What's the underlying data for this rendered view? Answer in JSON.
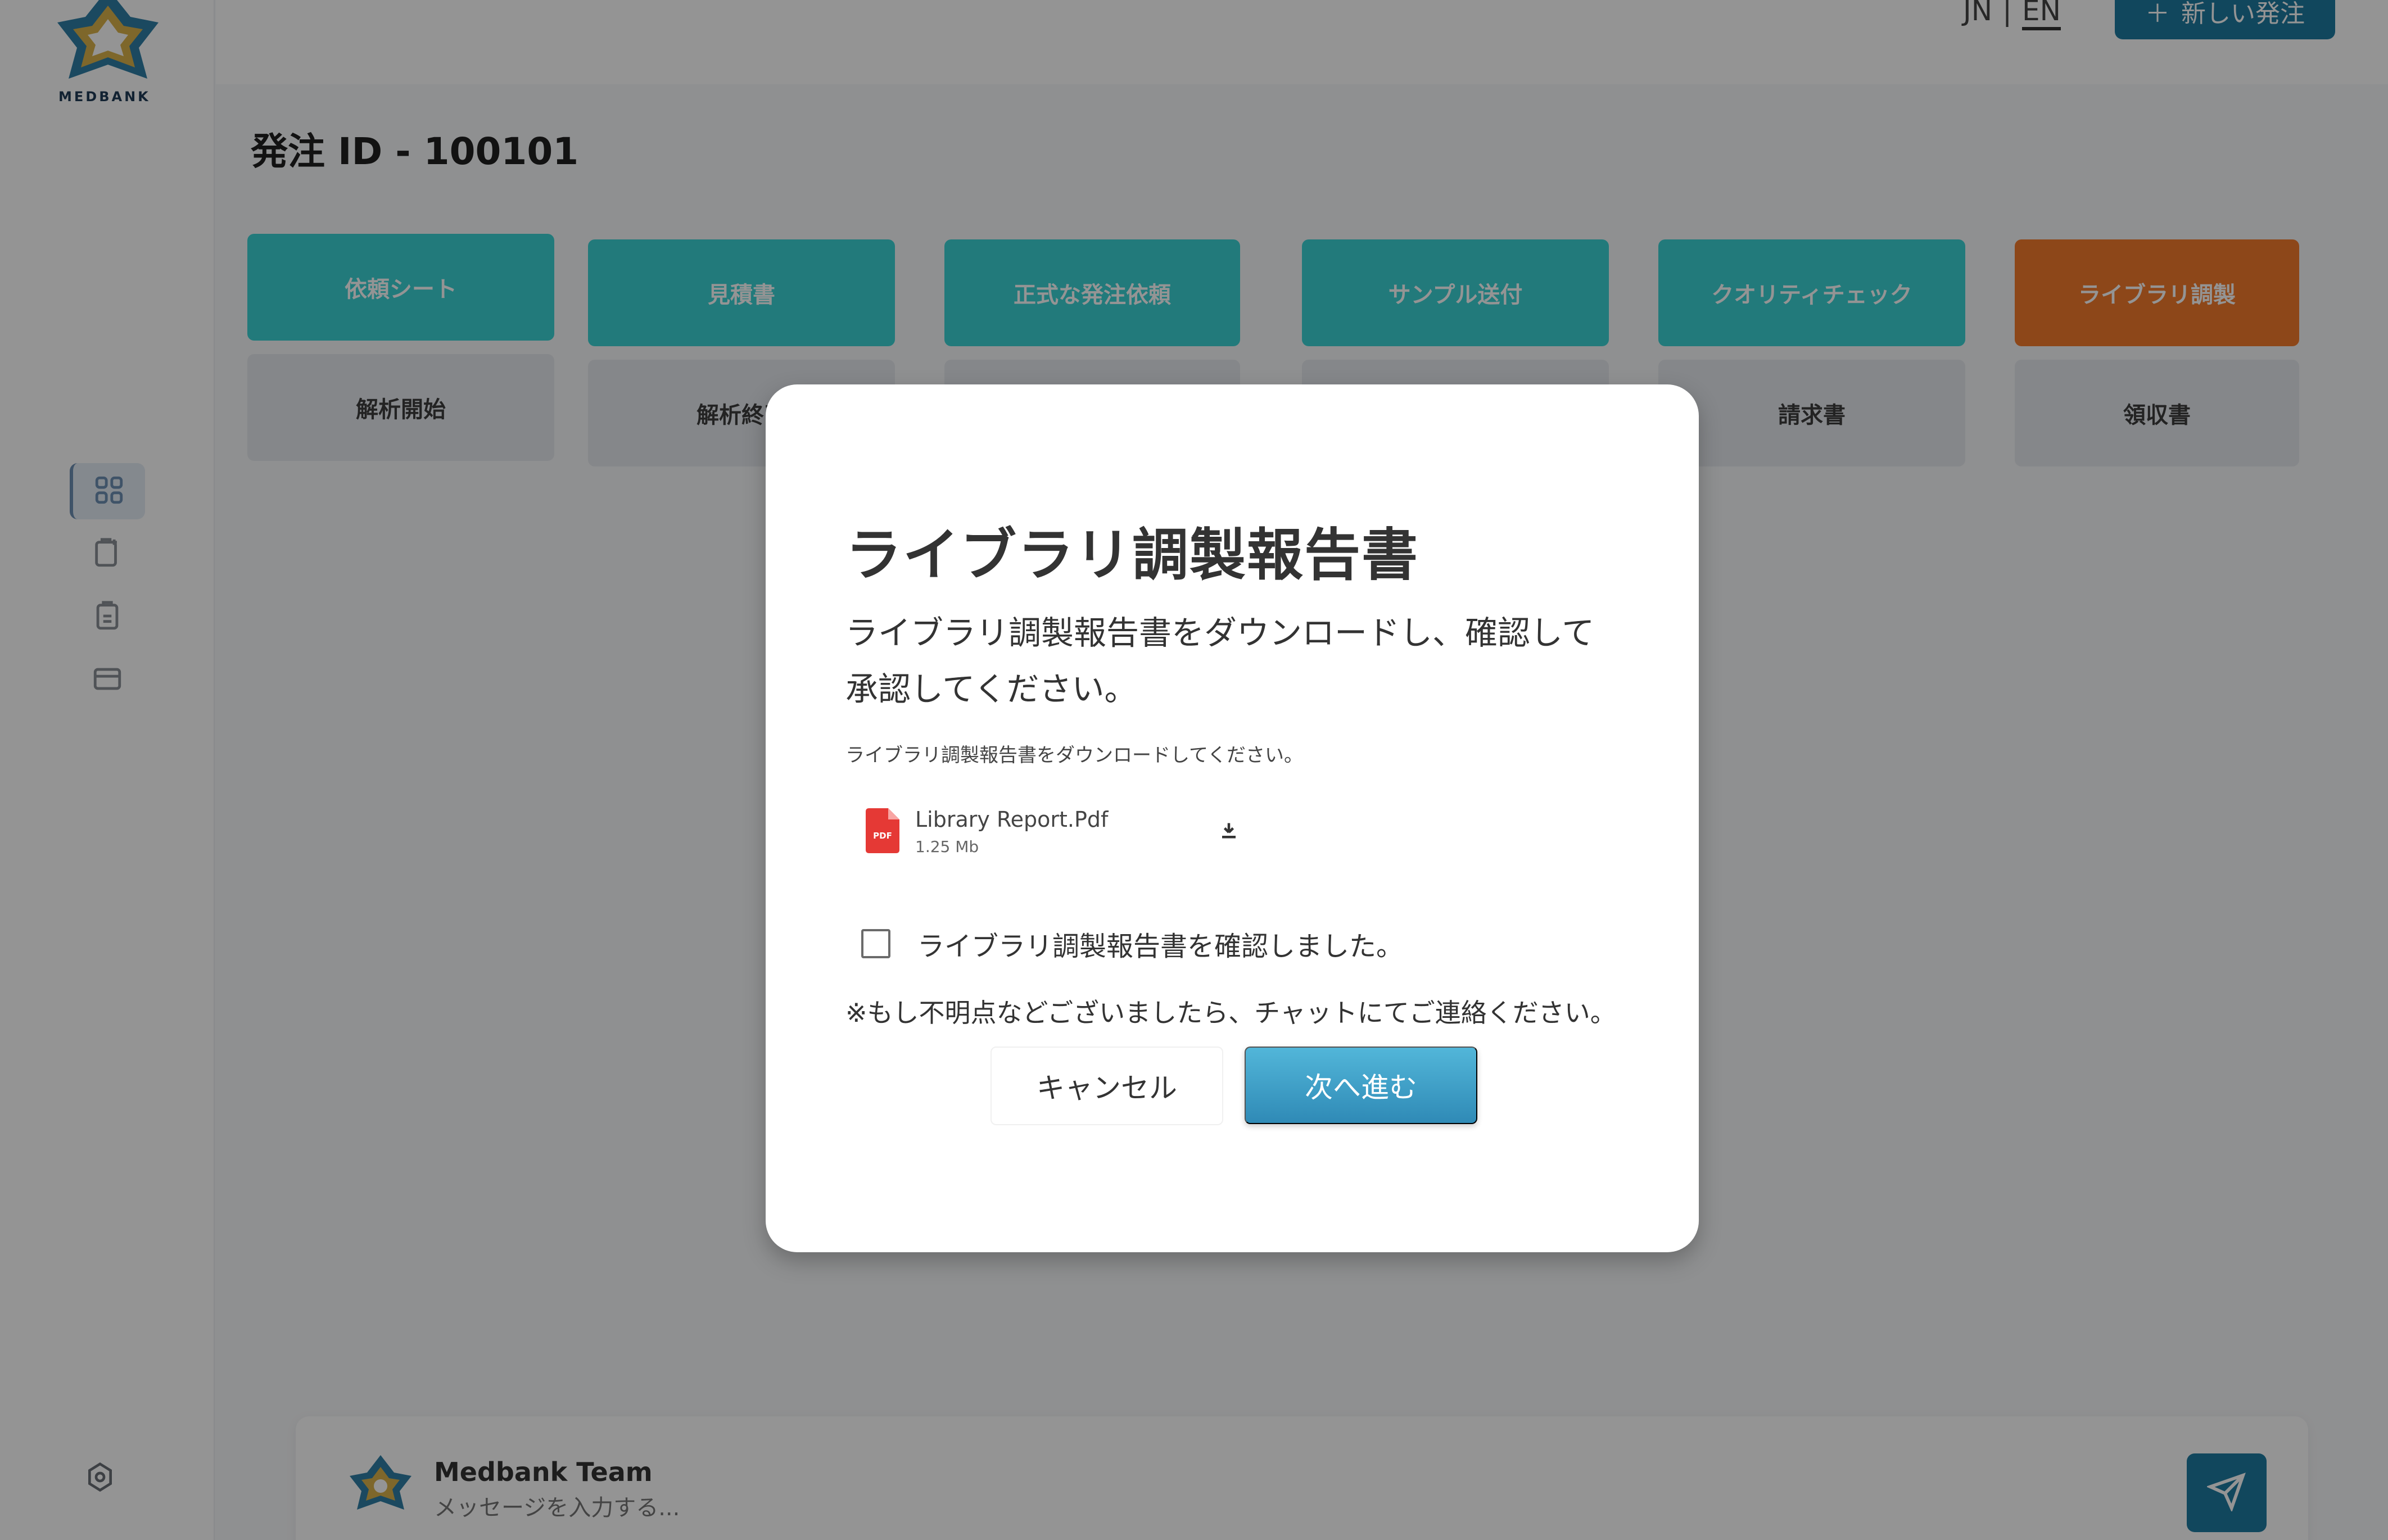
{
  "app": {
    "logo_text": "MEDBANK",
    "language": {
      "jn": "JN",
      "separator": "|",
      "en": "EN"
    },
    "new_order_button": "新しい発注",
    "page_title": "発注 ID - 100101",
    "steps": [
      {
        "top": "依頼シート",
        "bottom": "解析開始"
      },
      {
        "top": "見積書",
        "bottom": "解析終了"
      },
      {
        "top": "正式な発注依頼",
        "bottom": ""
      },
      {
        "top": "サンプル送付",
        "bottom": ""
      },
      {
        "top": "クオリティチェック",
        "bottom": "請求書"
      },
      {
        "top": "ライブラリ調製",
        "bottom": "領収書"
      }
    ],
    "chat": {
      "sender": "Medbank Team",
      "placeholder": "メッセージを入力する..."
    }
  },
  "modal": {
    "title": "ライブラリ調製報告書",
    "description_line1": "ライブラリ調製報告書をダウンロードし、確認して",
    "description_line2": "承認してください。",
    "hint": "ライブラリ調製報告書をダウンロードしてください。",
    "file": {
      "name": "Library Report.Pdf",
      "size": "1.25 Mb",
      "badge": "PDF"
    },
    "checkbox_label": "ライブラリ調製報告書を確認しました。",
    "checkbox_checked": false,
    "note": "※もし不明点などございましたら、チャットにてご連絡ください。",
    "cancel_label": "キャンセル",
    "next_label": "次へ進む"
  },
  "colors": {
    "step_teal": "#3cd3d5",
    "step_orange": "#f37a2c",
    "primary": "#1e7aa0",
    "pdf_red": "#e53935"
  }
}
